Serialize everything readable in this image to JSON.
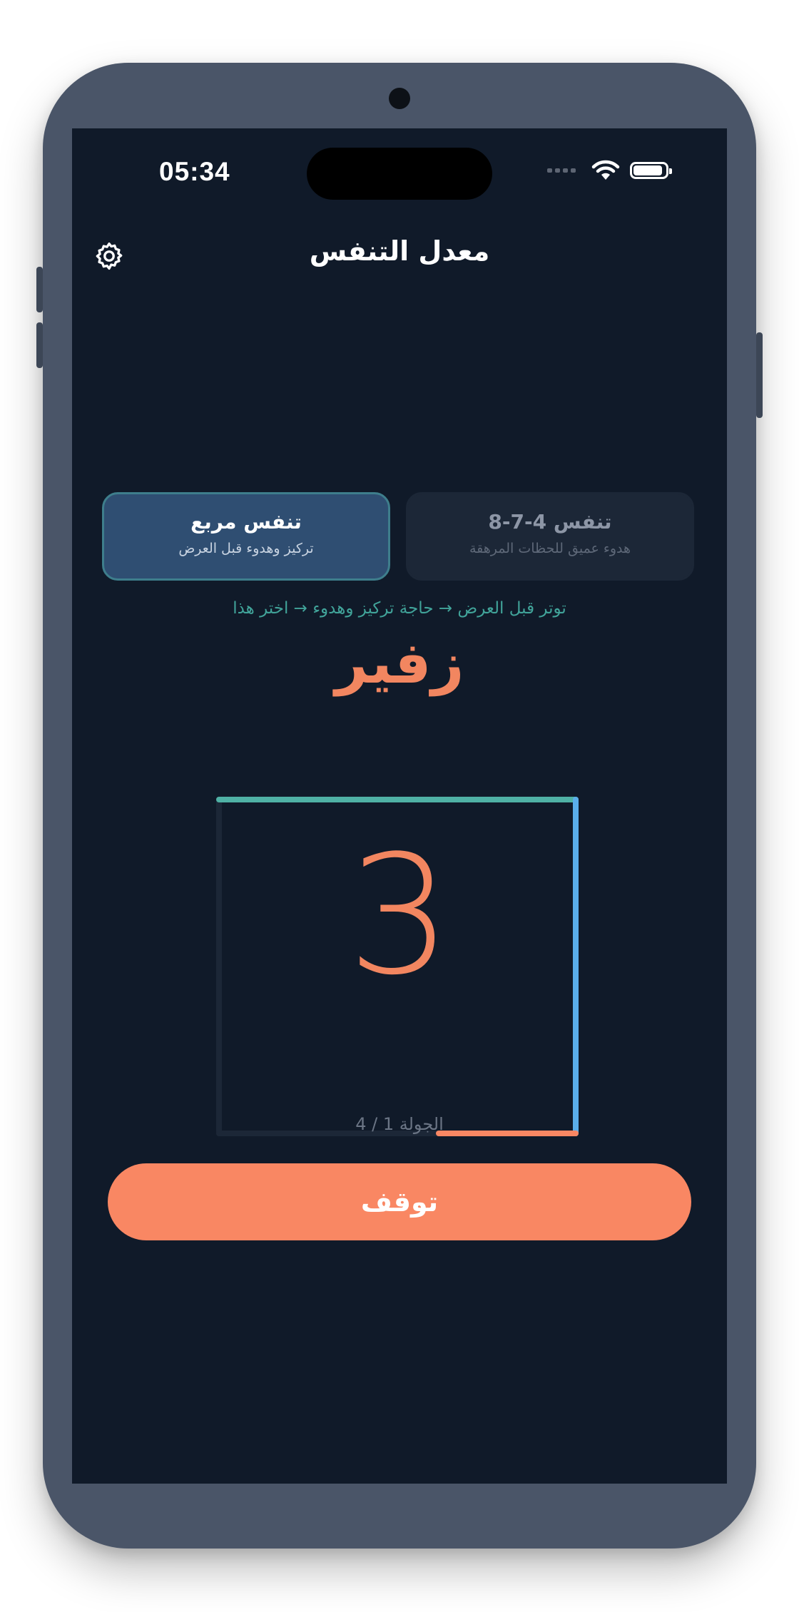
{
  "status_bar": {
    "time": "05:34",
    "battery_level": 0.9
  },
  "header": {
    "title": "معدل التنفس",
    "settings_icon": "gear-icon"
  },
  "modes": [
    {
      "name": "تنفس مربع",
      "description": "تركيز وهدوء قبل العرض",
      "selected": true
    },
    {
      "name": "تنفس 4-7-8",
      "description": "هدوء عميق للحظات المرهقة",
      "selected": false
    }
  ],
  "hint": "توتر قبل العرض → حاجة تركيز وهدوء → اختر هذا",
  "exercise": {
    "phase_label": "زفير",
    "count": "3",
    "round_label": "الجولة 1 / 4"
  },
  "actions": {
    "stop_label": "توقف"
  },
  "colors": {
    "background": "#101a29",
    "accent_orange": "#f98763",
    "teal": "#4fb1a5",
    "blue": "#5aaeea",
    "inactive_track": "#1c2737"
  }
}
